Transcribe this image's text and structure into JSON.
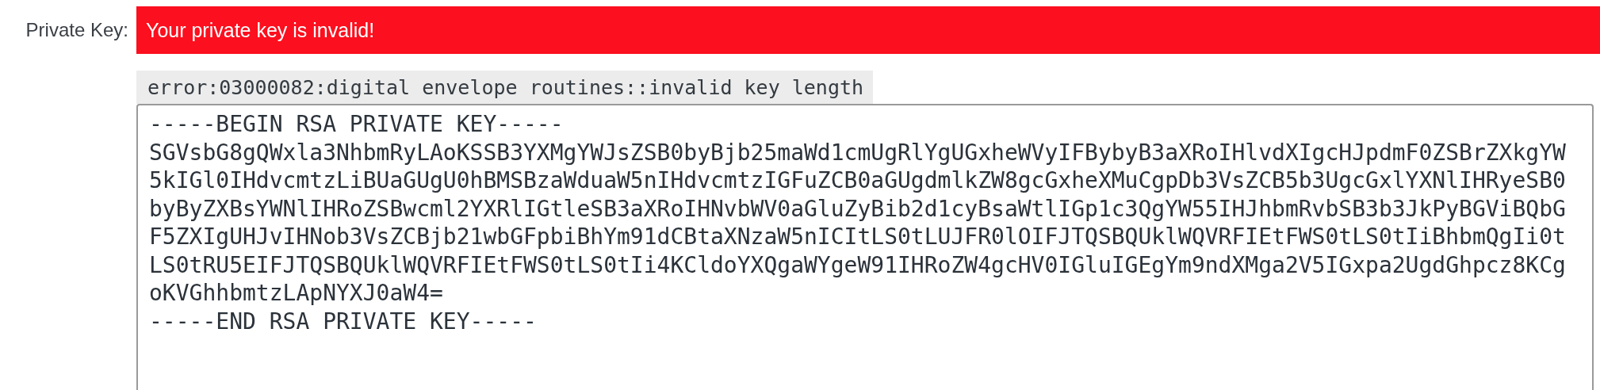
{
  "field": {
    "label": "Private Key:",
    "error_message": "Your private key is invalid!",
    "error_detail": "error:03000082:digital envelope routines::invalid key length",
    "value_lines": [
      "-----BEGIN RSA PRIVATE KEY-----",
      "SGVsbG8gQWxla3NhbmRyLAoKSSB3YXMgYWJsZSB0byBjb25maWd1cmUgRlYgUGxheWVyIFBybyB3aXRoIHlvdXIgcHJpdmF0ZSBrZXkgYW",
      "5kIGl0IHdvcmtzLiBUaGUgU0hBMSBzaWduaW5nIHdvcmtzIGFuZCB0aGUgdmlkZW8gcGxheXMuCgpDb3VsZCB5b3UgcGxlYXNlIHRyeSB0",
      "byByZXBsYWNlIHRoZSBwcml2YXRlIGtleSB3aXRoIHNvbWV0aGluZyBib2d1cyBsaWtlIGp1c3QgYW55IHJhbmRvbSB3b3JkPyBGViBQbG",
      "F5ZXIgUHJvIHNob3VsZCBjb21wbGFpbiBhYm91dCBtaXNzaW5nICItLS0tLUJFR0lOIFJTQSBQUklWQVRFIEtFWS0tLS0tIiBhbmQgIi0t",
      "LS0tRU5EIFJTQSBQUklWQVRFIEtFWS0tLS0tIi4KCldoYXQgaWYgeW91IHRoZW4gcHV0IGluIGEgYm9ndXMga2V5IGxpa2UgdGhpcz8KCg",
      "oKVGhhbmtzLApNYXJ0aW4=",
      "-----END RSA PRIVATE KEY-----"
    ]
  }
}
